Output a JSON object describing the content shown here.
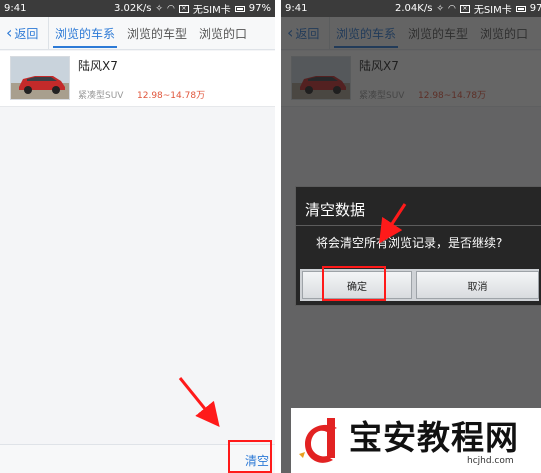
{
  "status_bar": {
    "time": "9:41",
    "speed_left": "3.02K/s",
    "speed_right": "2.04K/s",
    "sim": "无SIM卡",
    "battery": "97%"
  },
  "nav": {
    "back_label": "返回",
    "tabs": [
      {
        "label": "浏览的车系",
        "active": true
      },
      {
        "label": "浏览的车型",
        "active": false
      },
      {
        "label": "浏览的口",
        "active": false
      }
    ]
  },
  "history_item": {
    "name": "陆风X7",
    "type": "紧凑型SUV",
    "price": "12.98~14.78万"
  },
  "clear_button": "清空",
  "dialog": {
    "title": "清空数据",
    "message": "将会清空所有浏览记录，是否继续?",
    "confirm": "确定",
    "cancel": "取消"
  },
  "watermark": {
    "brand": "宝安教程网",
    "url": "hcjhd.com"
  },
  "colors": {
    "accent": "#2d7ad6",
    "price": "#e0553b",
    "highlight": "#ff1a1a"
  },
  "icons": [
    "chevron-left-icon",
    "signal-icon",
    "wifi-icon",
    "sim-icon",
    "battery-icon",
    "red-arrow-icon"
  ]
}
